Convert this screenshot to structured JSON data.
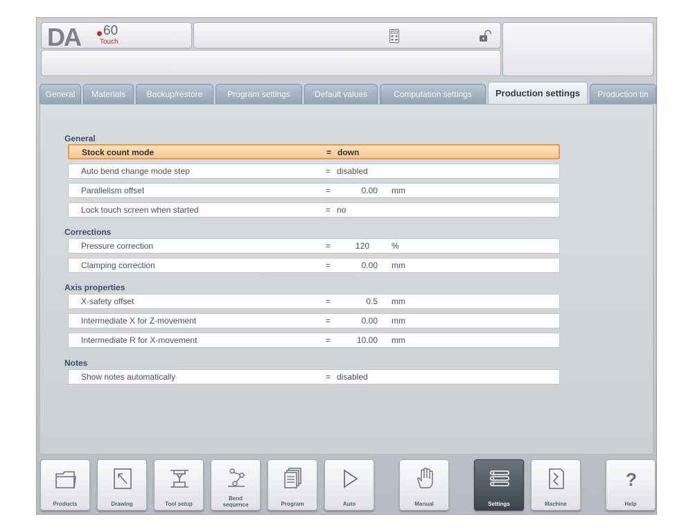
{
  "header": {
    "brand": "DA",
    "model": "60",
    "model_sub": "Touch"
  },
  "tabs": [
    {
      "label": "General",
      "active": false
    },
    {
      "label": "Materials",
      "active": false
    },
    {
      "label": "Backup/restore",
      "active": false
    },
    {
      "label": "Program settings",
      "active": false
    },
    {
      "label": "Default values",
      "active": false
    },
    {
      "label": "Computation settings",
      "active": false
    },
    {
      "label": "Production settings",
      "active": true
    },
    {
      "label": "Production tin",
      "active": false
    }
  ],
  "sections": {
    "general": {
      "title": "General",
      "rows": [
        {
          "label": "Stock count mode",
          "eq": "=",
          "value": "down"
        },
        {
          "label": "Auto bend change mode step",
          "eq": "=",
          "value": "disabled"
        },
        {
          "label": "Parallelism offset",
          "eq": "=",
          "value": "0.00",
          "unit": "mm"
        },
        {
          "label": "Lock touch screen when started",
          "eq": "=",
          "value": "no"
        }
      ]
    },
    "corrections": {
      "title": "Corrections",
      "rows": [
        {
          "label": "Pressure correction",
          "eq": "=",
          "value": "120",
          "unit": "%"
        },
        {
          "label": "Clamping correction",
          "eq": "=",
          "value": "0.00",
          "unit": "mm"
        }
      ]
    },
    "axis": {
      "title": "Axis properties",
      "rows": [
        {
          "label": "X-safety offset",
          "eq": "=",
          "value": "0.5",
          "unit": "mm"
        },
        {
          "label": "Intermediate X for Z-movement",
          "eq": "=",
          "value": "0.00",
          "unit": "mm"
        },
        {
          "label": "Intermediate R for X-movement",
          "eq": "=",
          "value": "10.00",
          "unit": "mm"
        }
      ]
    },
    "notes": {
      "title": "Notes",
      "rows": [
        {
          "label": "Show notes automatically",
          "eq": "=",
          "value": "disabled"
        }
      ]
    }
  },
  "toolbar": {
    "products": "Products",
    "drawing": "Drawing",
    "tool_setup": "Tool setup",
    "bend_sequence_1": "Bend",
    "bend_sequence_2": "sequence",
    "program": "Program",
    "auto": "Auto",
    "manual": "Manual",
    "settings": "Settings",
    "machine": "Machine",
    "help": "Help"
  },
  "icons": {
    "calculator": "calculator-icon",
    "lock": "unlocked-padlock-icon"
  },
  "colors": {
    "selected_row": "#f7c98e",
    "selected_border": "#e99a45",
    "tab_inactive": "#93a4b5",
    "brand_red": "#d6231f"
  }
}
